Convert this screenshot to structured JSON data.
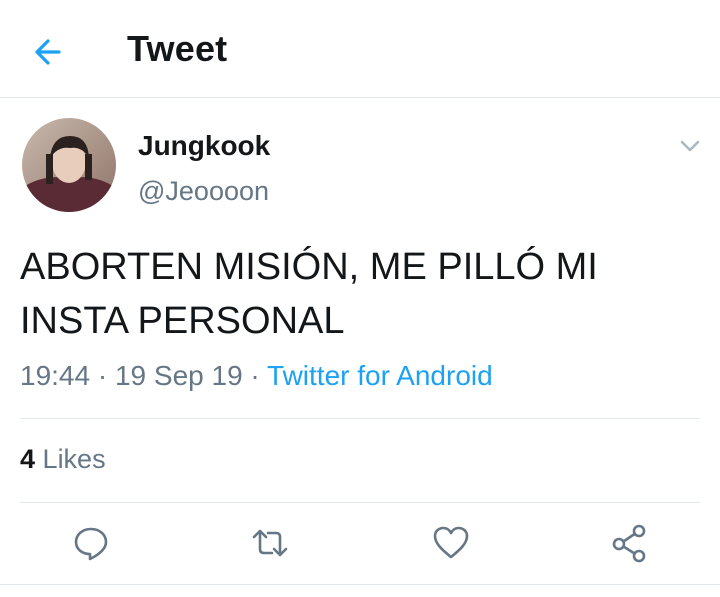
{
  "header": {
    "title": "Tweet",
    "back_icon": "arrow-left-icon"
  },
  "colors": {
    "accent": "#1da1f2",
    "text_primary": "#14171a",
    "text_secondary": "#657786",
    "divider": "#e1e8ed"
  },
  "tweet": {
    "author": {
      "display_name": "Jungkook",
      "handle": "@Jeoooon"
    },
    "text": "ABORTEN MISIÓN, ME PILLÓ MI\nINSTA PERSONAL",
    "time": "19:44",
    "separator": "·",
    "date": "19 Sep 19",
    "source": "Twitter for Android",
    "menu_icon": "chevron-down-icon"
  },
  "stats": {
    "likes_count": "4",
    "likes_label": "Likes"
  },
  "actions": [
    {
      "icon": "reply-icon"
    },
    {
      "icon": "retweet-icon"
    },
    {
      "icon": "heart-icon"
    },
    {
      "icon": "share-icon"
    }
  ]
}
